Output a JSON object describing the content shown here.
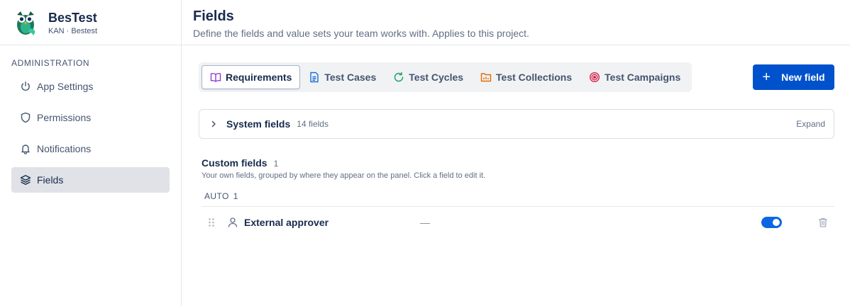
{
  "app": {
    "name": "BesTest",
    "subtitle": "KAN · Bestest"
  },
  "sidebar": {
    "section_label": "ADMINISTRATION",
    "items": [
      {
        "label": "App Settings",
        "icon": "power-icon"
      },
      {
        "label": "Permissions",
        "icon": "shield-icon"
      },
      {
        "label": "Notifications",
        "icon": "bell-icon"
      },
      {
        "label": "Fields",
        "icon": "layers-icon",
        "active": true
      }
    ]
  },
  "header": {
    "title": "Fields",
    "description": "Define the fields and value sets your team works with. Applies to this project."
  },
  "tabs": [
    {
      "label": "Requirements",
      "icon": "book-icon",
      "active": true
    },
    {
      "label": "Test Cases",
      "icon": "document-icon"
    },
    {
      "label": "Test Cycles",
      "icon": "refresh-icon"
    },
    {
      "label": "Test Collections",
      "icon": "folder-icon"
    },
    {
      "label": "Test Campaigns",
      "icon": "target-icon"
    }
  ],
  "new_field_label": "New field",
  "system_fields": {
    "label": "System fields",
    "count": "14 fields",
    "expand_label": "Expand"
  },
  "custom_fields": {
    "title": "Custom fields",
    "count": "1",
    "description": "Your own fields, grouped by where they appear on the panel. Click a field to edit it.",
    "groups": [
      {
        "label": "AUTO",
        "count": "1",
        "fields": [
          {
            "name": "External approver",
            "value": "—",
            "type_icon": "person-icon",
            "enabled": true
          }
        ]
      }
    ]
  },
  "colors": {
    "primary": "#0052cc",
    "toggle_on": "#0c66e4",
    "requirements_icon": "#8f3fd1",
    "test_cases_icon": "#1d6fd8",
    "test_cycles_icon": "#22a06b",
    "test_collections_icon": "#e06c00",
    "test_campaigns_icon": "#d6224b"
  }
}
